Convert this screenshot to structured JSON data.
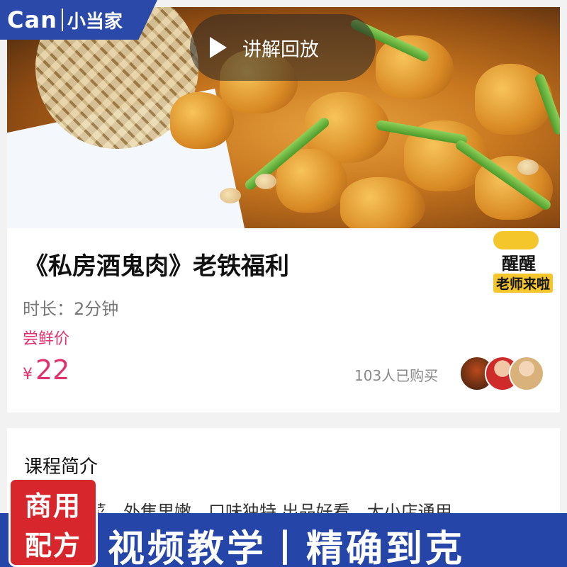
{
  "logo": {
    "brand": "Can",
    "name": "小当家"
  },
  "hero": {
    "replay_label": "讲解回放"
  },
  "course": {
    "title": "《私房酒鬼肉》老铁福利",
    "duration_label": "时长：2分钟",
    "price_label": "尝鲜价",
    "currency": "¥",
    "price": "22",
    "buyers": "103人已购买"
  },
  "badge": {
    "line1": "醒醒",
    "line2": "老师来啦"
  },
  "intro": {
    "heading": "课程简介",
    "body": "菜，外焦里嫩，口味独特 出品好看，大小店通用"
  },
  "banner": {
    "stamp_line1": "商用",
    "stamp_line2": "配方",
    "text": "视频教学丨精确到克"
  }
}
